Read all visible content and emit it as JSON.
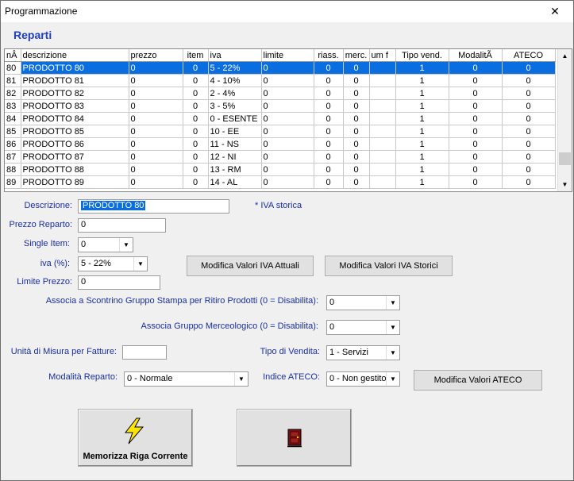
{
  "window": {
    "title": "Programmazione",
    "close": "✕"
  },
  "heading": "Reparti",
  "grid": {
    "columns": [
      "nÂ",
      "descrizione",
      "prezzo",
      "item",
      "iva",
      "limite",
      "riass.",
      "merc.",
      "um f",
      "Tipo vend.",
      "ModalitÃ",
      "ATECO"
    ],
    "rows": [
      [
        "80",
        "PRODOTTO 80",
        "0",
        "0",
        "5 - 22%",
        "0",
        "0",
        "0",
        "",
        "1",
        "0",
        "0"
      ],
      [
        "81",
        "PRODOTTO 81",
        "0",
        "0",
        "4 - 10%",
        "0",
        "0",
        "0",
        "",
        "1",
        "0",
        "0"
      ],
      [
        "82",
        "PRODOTTO 82",
        "0",
        "0",
        "2 - 4%",
        "0",
        "0",
        "0",
        "",
        "1",
        "0",
        "0"
      ],
      [
        "83",
        "PRODOTTO 83",
        "0",
        "0",
        "3 - 5%",
        "0",
        "0",
        "0",
        "",
        "1",
        "0",
        "0"
      ],
      [
        "84",
        "PRODOTTO 84",
        "0",
        "0",
        "0 - ESENTE",
        "0",
        "0",
        "0",
        "",
        "1",
        "0",
        "0"
      ],
      [
        "85",
        "PRODOTTO 85",
        "0",
        "0",
        "10 - EE",
        "0",
        "0",
        "0",
        "",
        "1",
        "0",
        "0"
      ],
      [
        "86",
        "PRODOTTO 86",
        "0",
        "0",
        "11 - NS",
        "0",
        "0",
        "0",
        "",
        "1",
        "0",
        "0"
      ],
      [
        "87",
        "PRODOTTO 87",
        "0",
        "0",
        "12 - NI",
        "0",
        "0",
        "0",
        "",
        "1",
        "0",
        "0"
      ],
      [
        "88",
        "PRODOTTO 88",
        "0",
        "0",
        "13 - RM",
        "0",
        "0",
        "0",
        "",
        "1",
        "0",
        "0"
      ],
      [
        "89",
        "PRODOTTO 89",
        "0",
        "0",
        "14 - AL",
        "0",
        "0",
        "0",
        "",
        "1",
        "0",
        "0"
      ]
    ]
  },
  "form": {
    "descrizione_label": "Descrizione:",
    "descrizione_value": "PRODOTTO 80",
    "iva_storica_note": "* IVA storica",
    "prezzo_label": "Prezzo Reparto:",
    "prezzo_value": "0",
    "single_item_label": "Single Item:",
    "single_item_value": "0",
    "iva_label": "iva (%):",
    "iva_value": "5 - 22%",
    "limite_label": "Limite Prezzo:",
    "limite_value": "0",
    "scontrino_label": "Associa a Scontrino Gruppo Stampa per Ritiro Prodotti (0 = Disabilita):",
    "scontrino_value": "0",
    "merceologico_label": "Associa Gruppo Merceologico (0 = Disabilita):",
    "merceologico_value": "0",
    "unita_label": "Unità di Misura per Fatture:",
    "unita_value": "",
    "tipo_vendita_label": "Tipo di Vendita:",
    "tipo_vendita_value": "1 - Servizi",
    "modalita_label": "Modalità Reparto:",
    "modalita_value": "0 - Normale",
    "ateco_label": "Indice ATECO:",
    "ateco_value": "0 - Non gestito"
  },
  "buttons": {
    "iva_attuali": "Modifica Valori IVA Attuali",
    "iva_storici": "Modifica Valori IVA Storici",
    "ateco": "Modifica Valori ATECO",
    "memorizza": "Memorizza Riga Corrente"
  },
  "icons": {
    "memorizza": "lightning-icon",
    "exit": "door-icon",
    "accent": "#0a6ee0",
    "label_color": "#1a2fa0"
  }
}
